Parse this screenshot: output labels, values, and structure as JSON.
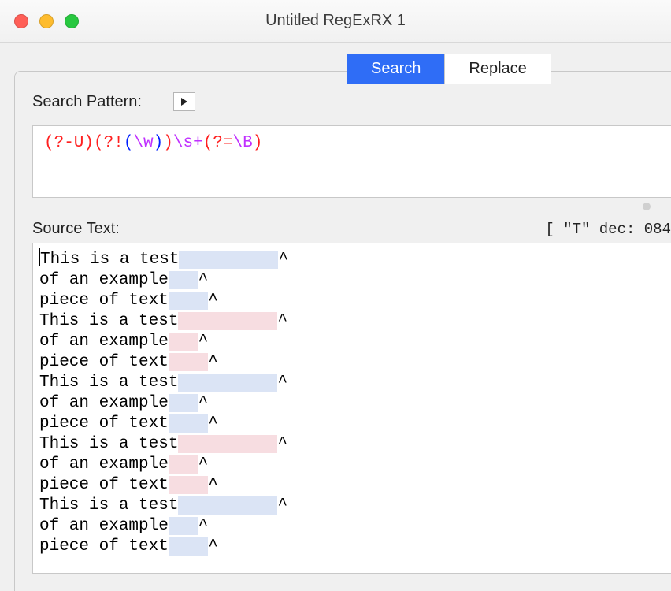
{
  "window": {
    "title": "Untitled RegExRX 1"
  },
  "tabs": {
    "search": "Search",
    "replace": "Replace",
    "active": "search"
  },
  "pattern": {
    "label": "Search Pattern:",
    "tokens": [
      {
        "t": "(?-U)",
        "c": "red"
      },
      {
        "t": "(?!",
        "c": "red"
      },
      {
        "t": "(",
        "c": "blue"
      },
      {
        "t": "\\w",
        "c": "purple"
      },
      {
        "t": ")",
        "c": "blue"
      },
      {
        "t": ")",
        "c": "red"
      },
      {
        "t": "\\s+",
        "c": "purple"
      },
      {
        "t": "(?=",
        "c": "red"
      },
      {
        "t": "\\B",
        "c": "purple"
      },
      {
        "t": ")",
        "c": "red"
      }
    ]
  },
  "source": {
    "label": "Source Text:",
    "status": "[ \"T\" dec: 084",
    "lines": [
      {
        "text": "This is a test",
        "pad": 10,
        "caret": "^",
        "hl": "blue",
        "cursor": true
      },
      {
        "text": "of an example",
        "pad": 3,
        "caret": "^",
        "hl": "blue"
      },
      {
        "text": "piece of text",
        "pad": 4,
        "caret": "^",
        "hl": "blue"
      },
      {
        "text": "This is a test",
        "pad": 10,
        "caret": "^",
        "hl": "pink"
      },
      {
        "text": "of an example",
        "pad": 3,
        "caret": "^",
        "hl": "pink"
      },
      {
        "text": "piece of text",
        "pad": 4,
        "caret": "^",
        "hl": "pink"
      },
      {
        "text": "This is a test",
        "pad": 10,
        "caret": "^",
        "hl": "blue"
      },
      {
        "text": "of an example",
        "pad": 3,
        "caret": "^",
        "hl": "blue"
      },
      {
        "text": "piece of text",
        "pad": 4,
        "caret": "^",
        "hl": "blue"
      },
      {
        "text": "This is a test",
        "pad": 10,
        "caret": "^",
        "hl": "pink"
      },
      {
        "text": "of an example",
        "pad": 3,
        "caret": "^",
        "hl": "pink"
      },
      {
        "text": "piece of text",
        "pad": 4,
        "caret": "^",
        "hl": "pink"
      },
      {
        "text": "This is a test",
        "pad": 10,
        "caret": "^",
        "hl": "blue"
      },
      {
        "text": "of an example",
        "pad": 3,
        "caret": "^",
        "hl": "blue"
      },
      {
        "text": "piece of text",
        "pad": 4,
        "caret": "^",
        "hl": "blue"
      }
    ]
  },
  "colors": {
    "accent": "#2f6df6",
    "hl_blue": "#dbe4f5",
    "hl_pink": "#f7dde1"
  }
}
